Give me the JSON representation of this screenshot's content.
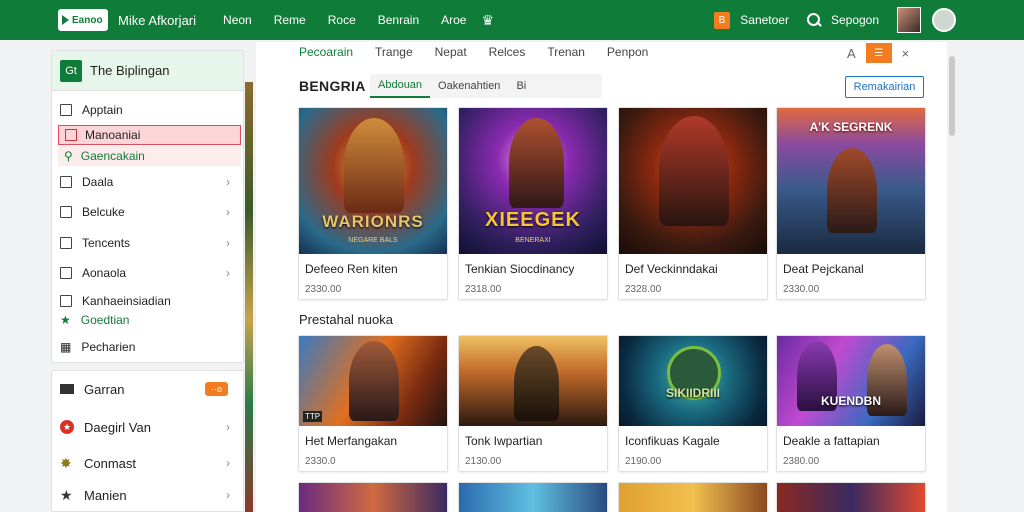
{
  "header": {
    "logo_text": "Eanoo",
    "app_title": "Mike Afkorjari",
    "nav": [
      "Neon",
      "Reme",
      "Roce",
      "Benrain",
      "Aroe"
    ],
    "badge": "B",
    "account_label": "Sanetoer",
    "search_label": "Sepogon"
  },
  "sidebar": {
    "header_title": "The Biplingan",
    "header_icon": "Gt",
    "items": [
      {
        "label": "Apptain",
        "chevron": false
      },
      {
        "label": "Manoaniai",
        "active": true
      },
      {
        "label": "Gaencakain",
        "sub": true
      },
      {
        "label": "Daala",
        "chevron": true
      },
      {
        "label": "Belcuke",
        "chevron": true
      },
      {
        "label": "Tencents",
        "chevron": true
      },
      {
        "label": "Aonaola",
        "chevron": true
      },
      {
        "label": "Kanhaeinsiadian",
        "chevron": false
      },
      {
        "label": "Goedtian",
        "sub_green": true
      },
      {
        "label": "Pecharien",
        "chevron": false
      }
    ]
  },
  "sidebar2": {
    "items": [
      {
        "label": "Garran",
        "pill": "··o"
      },
      {
        "label": "Daegirl Van",
        "chevron": true
      },
      {
        "label": "Conmast",
        "chevron": true
      },
      {
        "label": "Manien",
        "chevron": true
      }
    ]
  },
  "tabs": [
    "Pecoarain",
    "Trange",
    "Nepat",
    "Relces",
    "Trenan",
    "Penpon"
  ],
  "tabs_right": {
    "lang": "A",
    "close": "×"
  },
  "section1": {
    "title": "BENGRIA",
    "subtabs": [
      "Abdouan",
      "Oakenahtien",
      "Bi"
    ],
    "button": "Remakairian"
  },
  "section2": {
    "title": "Prestahal nuoka"
  },
  "row1": [
    {
      "title": "Defeeo Ren kiten",
      "meta": "2330.00",
      "art": "WARIONRS",
      "art_sub": "NEGARE BALS"
    },
    {
      "title": "Tenkian Siocdinancy",
      "meta": "2318.00",
      "art": "XIEEGEK",
      "art_sub": "BENERAXI"
    },
    {
      "title": "Def Veckinndakai",
      "meta": "2328.00",
      "art": ""
    },
    {
      "title": "Deat Pejckanal",
      "meta": "2330.00",
      "art": "A'K SEGRENK"
    }
  ],
  "row2": [
    {
      "title": "Het Merfangakan",
      "meta": "2330.0",
      "art": "TTP"
    },
    {
      "title": "Tonk Iwpartian",
      "meta": "2130.00",
      "art": ""
    },
    {
      "title": "Iconfikuas Kagale",
      "meta": "2190.00",
      "art": "SIKIIDRIII"
    },
    {
      "title": "Deakle a fattapian",
      "meta": "2380.00",
      "art": "KUENDBN"
    }
  ],
  "colors": {
    "brand": "#107c3a",
    "accent": "#f47c20",
    "link": "#1a73c8",
    "active_bg": "#fbd5d8"
  }
}
